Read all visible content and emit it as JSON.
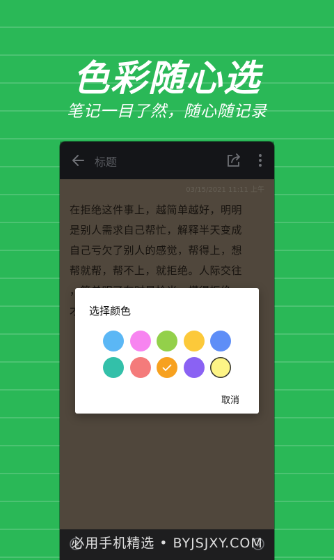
{
  "promo": {
    "headline": "色彩随心选",
    "subline": "笔记一目了然，随心随记录"
  },
  "colors": {
    "background": "#2ab857",
    "note_background": "#6f6354",
    "appbar": "#1d1e22"
  },
  "appbar": {
    "title_placeholder": "标题",
    "back_icon": "arrow-left-icon",
    "share_icon": "share-icon",
    "more_icon": "more-vertical-icon"
  },
  "note": {
    "timestamp": "03/15/2021 11:11 上午",
    "body_lines": [
      "在拒绝这件事上，越简单越好，明明",
      "是别人需求自己帮忙，解释半天变成",
      "自己亏欠了别人的感觉，帮得上，想",
      "帮就帮，帮不上，就拒绝。人际交往",
      "，简单明了有时最恰当，懂得拒绝，",
      "才"
    ]
  },
  "dialog": {
    "title": "选择颜色",
    "cancel_label": "取消",
    "swatches": [
      {
        "color": "#5bb7f5",
        "selected": false
      },
      {
        "color": "#f784f0",
        "selected": false
      },
      {
        "color": "#93d04a",
        "selected": false
      },
      {
        "color": "#fcc93a",
        "selected": false
      },
      {
        "color": "#5e8ef7",
        "selected": false
      },
      {
        "color": "#33c0a9",
        "selected": false
      },
      {
        "color": "#f47b7b",
        "selected": false
      },
      {
        "color": "#f7a11f",
        "selected": true
      },
      {
        "color": "#8a62f3",
        "selected": false
      },
      {
        "color": "#fdf486",
        "selected": false
      }
    ]
  },
  "watermark": "必用手机精选 • BYJSJXY.COM"
}
